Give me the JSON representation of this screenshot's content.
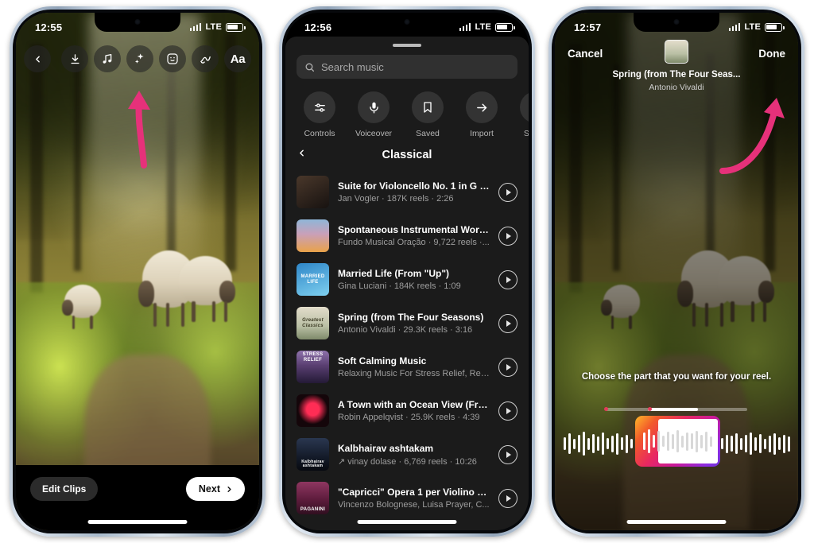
{
  "phones": [
    {
      "status": {
        "time": "12:55",
        "network": "LTE"
      },
      "toolbar": {
        "back": "back-chevron",
        "items": [
          "download-icon",
          "music-note-icon",
          "sparkles-icon",
          "sticker-smiley-icon",
          "squiggle-draw-icon",
          "text-aa-icon"
        ]
      },
      "footer": {
        "edit_clips": "Edit Clips",
        "next": "Next"
      },
      "annotation": "pink-arrow-pointing-to-music-icon"
    },
    {
      "status": {
        "time": "12:56",
        "network": "LTE"
      },
      "search": {
        "placeholder": "Search music"
      },
      "quick_actions": [
        {
          "label": "Controls",
          "icon": "sliders-icon"
        },
        {
          "label": "Voiceover",
          "icon": "microphone-icon"
        },
        {
          "label": "Saved",
          "icon": "bookmark-icon"
        },
        {
          "label": "Import",
          "icon": "arrow-right-icon"
        },
        {
          "label": "Sound",
          "icon": "speaker-icon"
        }
      ],
      "category": {
        "title": "Classical",
        "back": "back-chevron"
      },
      "songs": [
        {
          "title": "Suite for Violoncello No. 1 in G Maj...",
          "subtitle": "Jan Vogler · 187K reels · 2:26",
          "art_label": "",
          "art_colors": [
            "#3b2c22",
            "#1d1713"
          ]
        },
        {
          "title": "Spontaneous Instrumental Worship...",
          "subtitle": "Fundo Musical Oração · 9,722 reels ·...",
          "art_label": "",
          "art_colors": [
            "#8fb6d8",
            "#e9a24a"
          ]
        },
        {
          "title": "Married Life (From \"Up\")",
          "subtitle": "Gina Luciani · 184K reels · 1:09",
          "art_label": "MARRIED LIFE",
          "art_colors": [
            "#2e86c8",
            "#5ec0e8"
          ]
        },
        {
          "title": "Spring (from The Four Seasons)",
          "subtitle": "Antonio Vivaldi · 29.3K reels · 3:16",
          "art_label": "Greatest Classics",
          "art_colors": [
            "#d9d4c4",
            "#8d9a7c"
          ]
        },
        {
          "title": "Soft Calming Music",
          "subtitle": "Relaxing Music For Stress Relief, Rel...",
          "art_label": "STRESS RELIEF",
          "art_colors": [
            "#6f5a8e",
            "#2b2140"
          ]
        },
        {
          "title": "A Town with an Ocean View (From...",
          "subtitle": "Robin Appelqvist · 25.9K reels · 4:39",
          "art_label": "",
          "art_colors": [
            "#120407",
            "#2a060e"
          ]
        },
        {
          "title": "Kalbhairav ashtakam",
          "subtitle": "↗ vinay dolase · 6,769 reels · 10:26",
          "art_label": "Kalbhairav ashtakam",
          "art_colors": [
            "#1b2436",
            "#0a0d14"
          ]
        },
        {
          "title": "\"Capricci\" Opera 1 per Violino solo:...",
          "subtitle": "Vincenzo Bolognese, Luisa Prayer, C...",
          "art_label": "PAGANINI",
          "art_colors": [
            "#7d2a52",
            "#3a0f26"
          ]
        }
      ]
    },
    {
      "status": {
        "time": "12:57",
        "network": "LTE"
      },
      "header": {
        "cancel": "Cancel",
        "done": "Done"
      },
      "track": {
        "title": "Spring (from The Four Seas...",
        "artist": "Antonio Vivaldi",
        "cover_label": "Greatest Classics"
      },
      "hint": "Choose the part that you want for your reel.",
      "annotation": "pink-arrow-pointing-to-done-button"
    }
  ],
  "colors": {
    "accent_pink": "#e6317a",
    "sheet_bg": "#1b1b1b",
    "search_bg": "#303030",
    "subtitle": "#9d9d9d"
  }
}
